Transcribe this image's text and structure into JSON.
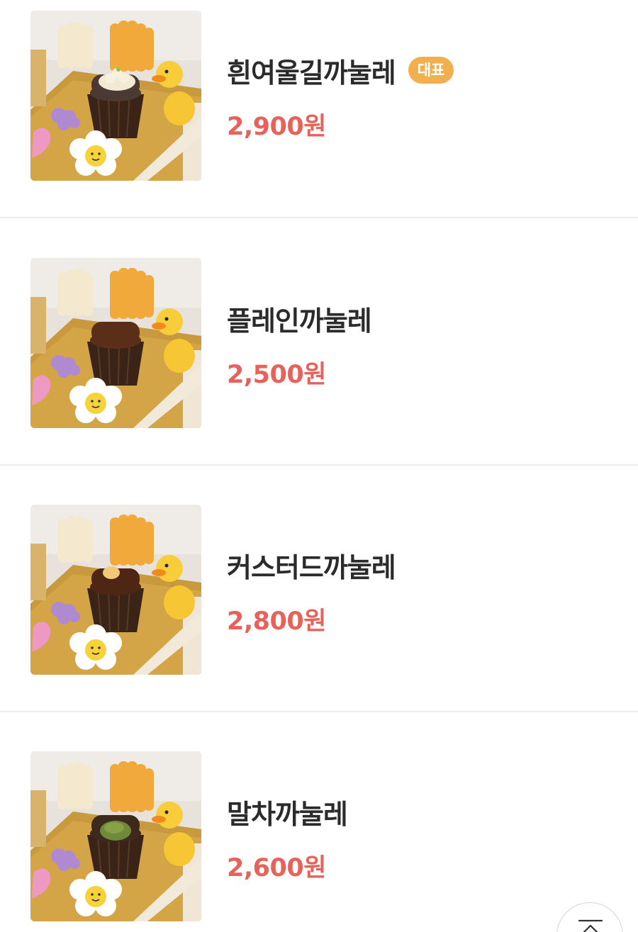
{
  "menu": {
    "items": [
      {
        "name": "흰여울길까눌레",
        "badge": "대표",
        "price": "2,900원",
        "cake_color": "#4a3a32",
        "topping": "cream",
        "image_icon": "canele-photo"
      },
      {
        "name": "플레인까눌레",
        "badge": "",
        "price": "2,500원",
        "cake_color": "#5a2e18",
        "topping": "none",
        "image_icon": "canele-photo"
      },
      {
        "name": "커스터드까눌레",
        "badge": "",
        "price": "2,800원",
        "cake_color": "#4f2614",
        "topping": "custard",
        "image_icon": "canele-photo"
      },
      {
        "name": "말차까눌레",
        "badge": "",
        "price": "2,600원",
        "cake_color": "#3d2a1c",
        "topping": "matcha",
        "image_icon": "canele-photo"
      }
    ]
  },
  "colors": {
    "price": "#e7625a",
    "badge_bg": "#f1b04d",
    "divider": "#ececec",
    "name": "#2b2b2b"
  },
  "scroll_top": {
    "icon": "arrow-up-to-top-icon"
  }
}
